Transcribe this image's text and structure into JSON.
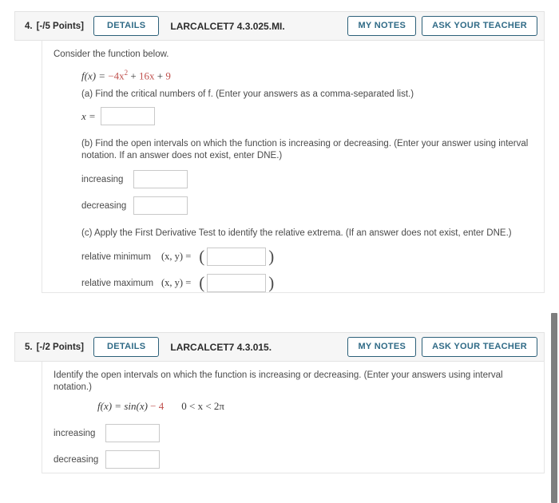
{
  "questions": [
    {
      "number": "4.",
      "points": "[-/5 Points]",
      "details_label": "DETAILS",
      "code": "LARCALCET7 4.3.025.MI.",
      "my_notes_label": "MY NOTES",
      "ask_teacher_label": "ASK YOUR TEACHER",
      "intro": "Consider the function below.",
      "formula": {
        "lhs": "f(x) = ",
        "t1": "−4x",
        "exp": "2",
        "op1": " + ",
        "t2": "16x",
        "op2": " + ",
        "t3": "9"
      },
      "part_a": {
        "prompt": "(a) Find the critical numbers of f. (Enter your answers as a comma-separated list.)",
        "x_label": "x =",
        "x_value": "",
        "x_placeholder": ""
      },
      "part_b": {
        "prompt": "(b) Find the open intervals on which the function is increasing or decreasing. (Enter your answer using interval notation. If an answer does not exist, enter DNE.)",
        "increasing_label": "increasing",
        "increasing_value": "",
        "decreasing_label": "decreasing",
        "decreasing_value": ""
      },
      "part_c": {
        "prompt": "(c) Apply the First Derivative Test to identify the relative extrema. (If an answer does not exist, enter DNE.)",
        "min_label": "relative minimum",
        "min_xy": "(x, y)  =",
        "min_value": "",
        "max_label": "relative maximum",
        "max_xy": "(x, y)  =",
        "max_value": "",
        "open_paren": "(",
        "close_paren": ")"
      }
    },
    {
      "number": "5.",
      "points": "[-/2 Points]",
      "details_label": "DETAILS",
      "code": "LARCALCET7 4.3.015.",
      "my_notes_label": "MY NOTES",
      "ask_teacher_label": "ASK YOUR TEACHER",
      "intro": "Identify the open intervals on which the function is increasing or decreasing. (Enter your answers using interval notation.)",
      "formula": {
        "lhs": "f(x) = sin(x) ",
        "t1": "− 4",
        "domain": "0 < x < 2π"
      },
      "increasing_label": "increasing",
      "increasing_value": "",
      "decreasing_label": "decreasing",
      "decreasing_value": ""
    }
  ],
  "colors": {
    "button_border": "#2c6079",
    "button_text": "#2f6a86",
    "header_bg": "#f6f6f6",
    "math_accent": "#c0504d",
    "scrollbar": "#7e7e7e"
  }
}
